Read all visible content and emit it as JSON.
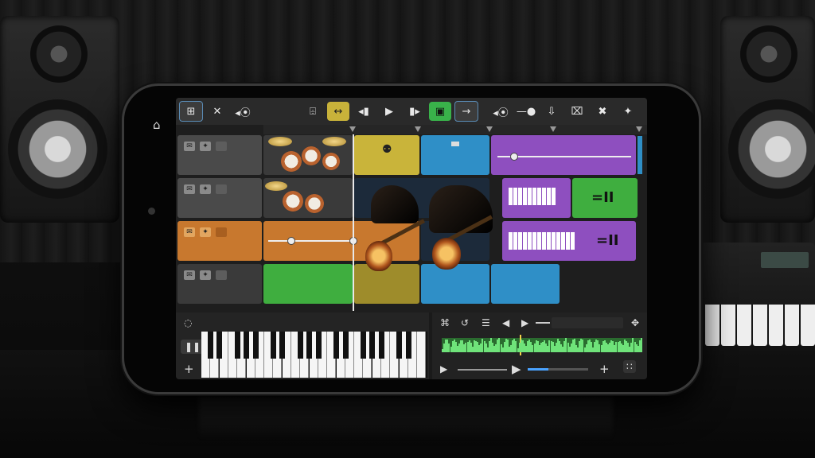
{
  "app": {
    "title": ""
  },
  "toolbar": {
    "buttons": [
      {
        "name": "browser-button",
        "icon": "⊞"
      },
      {
        "name": "cut-button",
        "icon": "✕"
      },
      {
        "name": "volume-button",
        "icon": "◂⦿"
      },
      {
        "name": "loop-select-button",
        "icon": "⌹"
      },
      {
        "name": "metronome-button",
        "icon": "↔"
      },
      {
        "name": "rewind-button",
        "icon": "◂▮"
      },
      {
        "name": "play-button",
        "icon": "▶"
      },
      {
        "name": "forward-button",
        "icon": "▮▸"
      },
      {
        "name": "record-button",
        "icon": "▣"
      },
      {
        "name": "next-button",
        "icon": "→"
      },
      {
        "name": "speaker-button",
        "icon": "◂⦿"
      },
      {
        "name": "tempo-slider",
        "icon": "—●"
      },
      {
        "name": "mic-button",
        "icon": "⇩"
      },
      {
        "name": "shuffle-button",
        "icon": "⌧"
      },
      {
        "name": "fx-button",
        "icon": "✖"
      },
      {
        "name": "settings-button",
        "icon": "✦"
      }
    ],
    "highlighted_color": "#c8b23a",
    "record_color": "#39b24a"
  },
  "tracks": [
    {
      "header_color": "#4a4a4a",
      "regions": [
        {
          "color": "#c9b43a"
        },
        {
          "color": "#2f8fc7"
        },
        {
          "color": "#8e4fbf"
        }
      ]
    },
    {
      "header_color": "#4a4a4a",
      "regions": [
        {
          "color": "#8e4fbf"
        },
        {
          "color": "#3fae3f"
        }
      ]
    },
    {
      "header_color": "#c8782e",
      "regions": [
        {
          "color": "#c8782e"
        },
        {
          "color": "#8e4fbf"
        }
      ]
    },
    {
      "header_color": "#3a3a3a",
      "regions": [
        {
          "color": "#3fae3f"
        },
        {
          "color": "#c9b43a"
        },
        {
          "color": "#2f8fc7"
        }
      ]
    }
  ],
  "colors": {
    "yellow": "#c9b43a",
    "blue": "#2f8fc7",
    "purple": "#8e4fbf",
    "green": "#3fae3f",
    "orange": "#c8782e"
  },
  "bottom": {
    "keyboard_icons": [
      "lock-icon",
      "pause-icon",
      "plus-icon"
    ],
    "mixer_icons": [
      "bicycle-icon",
      "undo-icon",
      "eq-icon",
      "prev-icon",
      "play-icon",
      "pan-icon"
    ],
    "transport": {
      "play_icon": "▶",
      "add_icon": "+",
      "grid_icon": "∷"
    }
  }
}
